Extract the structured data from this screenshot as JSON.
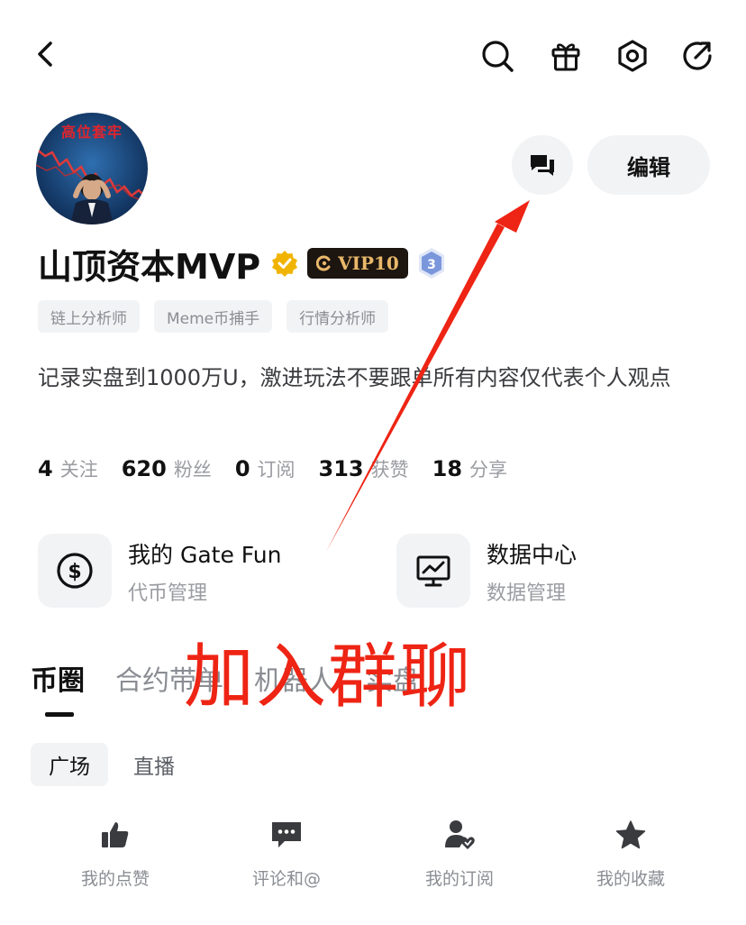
{
  "header": {
    "icons": [
      "back-icon",
      "search-icon",
      "gift-icon",
      "settings-icon",
      "share-icon"
    ]
  },
  "profile": {
    "avatar_text": "高位套牢",
    "username": "山顶资本MVP",
    "vip_label": "VIP10",
    "level": "3",
    "edit_label": "编辑",
    "tags": [
      "链上分析师",
      "Meme币捕手",
      "行情分析师"
    ],
    "bio": "记录实盘到1000万U，激进玩法不要跟单所有内容仅代表个人观点"
  },
  "stats": [
    {
      "num": "4",
      "label": "关注"
    },
    {
      "num": "620",
      "label": "粉丝"
    },
    {
      "num": "0",
      "label": "订阅"
    },
    {
      "num": "313",
      "label": "获赞"
    },
    {
      "num": "18",
      "label": "分享"
    }
  ],
  "cards": {
    "gatefun": {
      "title": "我的 Gate Fun",
      "subtitle": "代币管理"
    },
    "data_center": {
      "title": "数据中心",
      "subtitle": "数据管理"
    }
  },
  "tabs": [
    "币圈",
    "合约带单",
    "机器人",
    "实盘"
  ],
  "subtabs": [
    "广场",
    "直播"
  ],
  "bottom_nav": [
    {
      "label": "我的点赞",
      "icon": "thumbs-up-icon"
    },
    {
      "label": "评论和@",
      "icon": "comment-icon"
    },
    {
      "label": "我的订阅",
      "icon": "subscribe-icon"
    },
    {
      "label": "我的收藏",
      "icon": "star-icon"
    }
  ],
  "annotation": {
    "text": "加入群聊",
    "color": "#ee2414"
  },
  "colors": {
    "vip_gold": "#e9b86a",
    "verified": "#f0b400",
    "level_blue": "#6f8fd6"
  }
}
